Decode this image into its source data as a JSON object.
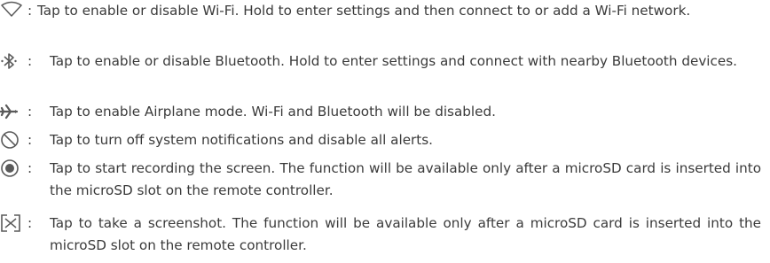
{
  "items": [
    {
      "icon": "wifi-icon",
      "colon": ":",
      "text": "Tap to enable or disable Wi-Fi. Hold to enter settings and then connect to or add a Wi-Fi network."
    },
    {
      "icon": "bluetooth-icon",
      "colon": ":",
      "text": "Tap to enable or disable Bluetooth. Hold to enter settings and connect with nearby Bluetooth devices."
    },
    {
      "icon": "airplane-icon",
      "colon": ":",
      "text": "Tap to enable Airplane mode. Wi-Fi and Bluetooth will be disabled."
    },
    {
      "icon": "do-not-disturb-icon",
      "colon": ":",
      "text": "Tap to turn off system notifications and disable all alerts."
    },
    {
      "icon": "screen-record-icon",
      "colon": ":",
      "text": "Tap to start recording the screen. The function will be available only after a microSD card is inserted into the microSD slot on the remote controller."
    },
    {
      "icon": "screenshot-icon",
      "colon": ":",
      "text": "Tap to take a screenshot. The function will be available only after a microSD card is inserted into the microSD slot on the remote controller."
    }
  ]
}
